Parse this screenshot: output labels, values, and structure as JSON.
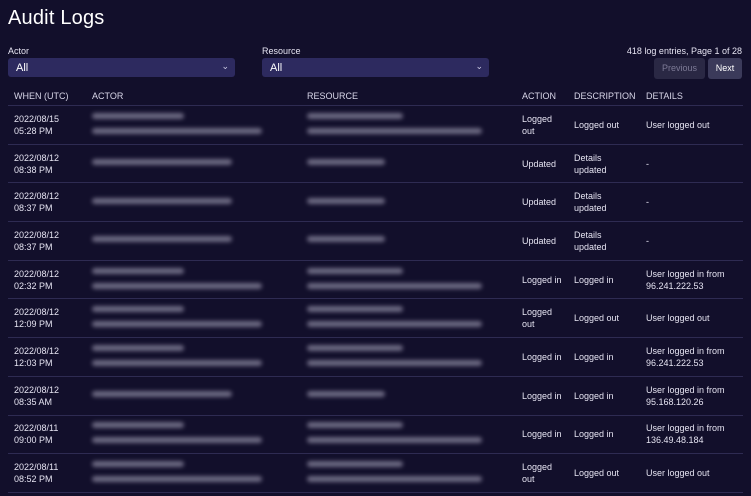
{
  "page": {
    "title": "Audit Logs"
  },
  "filters": {
    "actor": {
      "label": "Actor",
      "value": "All"
    },
    "resource": {
      "label": "Resource",
      "value": "All"
    }
  },
  "pagination": {
    "summary": "418 log entries, Page 1 of 28",
    "previous_label": "Previous",
    "next_label": "Next"
  },
  "table": {
    "headers": [
      "WHEN (UTC)",
      "ACTOR",
      "RESOURCE",
      "ACTION",
      "DESCRIPTION",
      "DETAILS"
    ],
    "rows": [
      {
        "date": "2022/08/15",
        "time": "05:28 PM",
        "actor_lines": 2,
        "resource_lines": 2,
        "action": "Logged out",
        "description": "Logged out",
        "details": "User logged out"
      },
      {
        "date": "2022/08/12",
        "time": "08:38 PM",
        "actor_lines": 1,
        "resource_lines": 1,
        "action": "Updated",
        "description": "Details updated",
        "details": "-"
      },
      {
        "date": "2022/08/12",
        "time": "08:37 PM",
        "actor_lines": 1,
        "resource_lines": 1,
        "action": "Updated",
        "description": "Details updated",
        "details": "-"
      },
      {
        "date": "2022/08/12",
        "time": "08:37 PM",
        "actor_lines": 1,
        "resource_lines": 1,
        "action": "Updated",
        "description": "Details updated",
        "details": "-"
      },
      {
        "date": "2022/08/12",
        "time": "02:32 PM",
        "actor_lines": 2,
        "resource_lines": 2,
        "action": "Logged in",
        "description": "Logged in",
        "details": "User logged in from 96.241.222.53"
      },
      {
        "date": "2022/08/12",
        "time": "12:09 PM",
        "actor_lines": 2,
        "resource_lines": 2,
        "action": "Logged out",
        "description": "Logged out",
        "details": "User logged out"
      },
      {
        "date": "2022/08/12",
        "time": "12:03 PM",
        "actor_lines": 2,
        "resource_lines": 2,
        "action": "Logged in",
        "description": "Logged in",
        "details": "User logged in from 96.241.222.53"
      },
      {
        "date": "2022/08/12",
        "time": "08:35 AM",
        "actor_lines": 1,
        "resource_lines": 1,
        "action": "Logged in",
        "description": "Logged in",
        "details": "User logged in from 95.168.120.26"
      },
      {
        "date": "2022/08/11",
        "time": "09:00 PM",
        "actor_lines": 2,
        "resource_lines": 2,
        "action": "Logged in",
        "description": "Logged in",
        "details": "User logged in from 136.49.48.184"
      },
      {
        "date": "2022/08/11",
        "time": "08:52 PM",
        "actor_lines": 2,
        "resource_lines": 2,
        "action": "Logged out",
        "description": "Logged out",
        "details": "User logged out"
      }
    ]
  },
  "colors": {
    "background": "#120f2b",
    "select_bg": "#2d2a5f",
    "divider": "#2e2b52"
  }
}
